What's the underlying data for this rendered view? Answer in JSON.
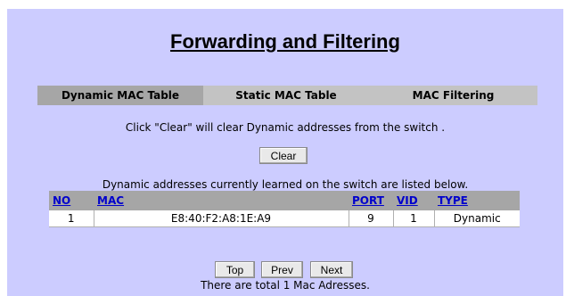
{
  "title": "Forwarding and Filtering",
  "tabs": [
    {
      "label": "Dynamic MAC Table",
      "active": true
    },
    {
      "label": "Static MAC Table",
      "active": false
    },
    {
      "label": "MAC Filtering",
      "active": false
    }
  ],
  "clear_hint": "Click \"Clear\" will clear Dynamic addresses from the switch .",
  "clear_button": "Clear",
  "listed_text": "Dynamic addresses currently learned on the switch are listed below.",
  "table": {
    "headers": {
      "no": "NO",
      "mac": "MAC",
      "port": "PORT",
      "vid": "VID",
      "type": "TYPE"
    },
    "rows": [
      {
        "no": "1",
        "mac": "E8:40:F2:A8:1E:A9",
        "port": "9",
        "vid": "1",
        "type": "Dynamic"
      }
    ]
  },
  "nav": {
    "top": "Top",
    "prev": "Prev",
    "next": "Next"
  },
  "total_text": "There are total 1 Mac Adresses.",
  "colors": {
    "page_bg": "#ccccff",
    "tab_bar": "#c3c3c3",
    "tab_active": "#a6a6a6",
    "header_link": "#0000cc"
  }
}
